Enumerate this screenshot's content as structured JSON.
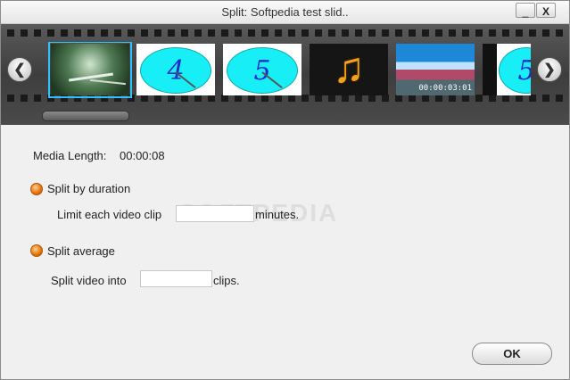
{
  "window": {
    "title": "Split: Softpedia test slid..",
    "minimize_label": "_",
    "close_label": "X"
  },
  "filmstrip": {
    "prev_label": "❮",
    "next_label": "❯",
    "thumbnails": [
      {
        "kind": "image"
      },
      {
        "kind": "clock",
        "digit": "4"
      },
      {
        "kind": "clock",
        "digit": "5"
      },
      {
        "kind": "audio",
        "glyph": "♫"
      },
      {
        "kind": "video",
        "timecode": "00:00:03:01"
      },
      {
        "kind": "clock",
        "digit": "5"
      }
    ]
  },
  "media": {
    "label": "Media Length:",
    "value": "00:00:08"
  },
  "options": {
    "by_duration": {
      "label": "Split by duration",
      "prefix": "Limit each video clip",
      "suffix": "minutes.",
      "value": ""
    },
    "average": {
      "label": "Split average",
      "prefix": "Split video into",
      "suffix": "clips.",
      "value": ""
    }
  },
  "watermark": "SOFTPEDIA",
  "ok_label": "OK",
  "colors": {
    "accent": "#e06a00",
    "selection": "#2ec0ff",
    "clock_face": "#17eef6"
  }
}
